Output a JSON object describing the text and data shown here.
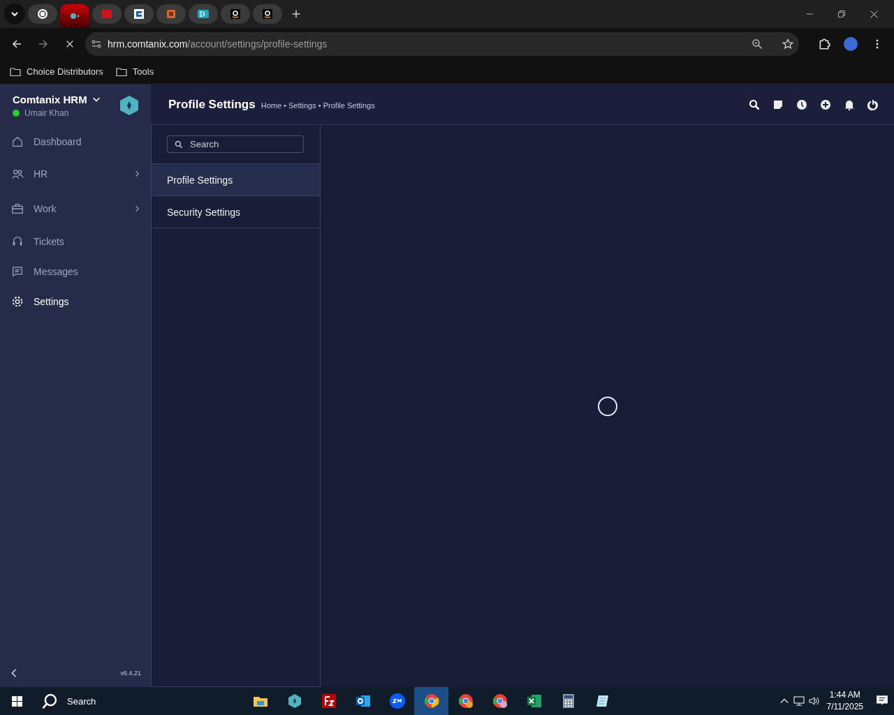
{
  "browser": {
    "tabs": [
      {
        "selected": false
      },
      {
        "selected": true
      },
      {
        "selected": false
      },
      {
        "selected": false
      },
      {
        "selected": false
      },
      {
        "selected": false
      },
      {
        "selected": false
      },
      {
        "selected": false
      }
    ],
    "url": {
      "host": "hrm.comtanix.com",
      "path": "/account/settings/profile-settings"
    },
    "bookmarks": [
      {
        "label": "Choice Distributors"
      },
      {
        "label": "Tools"
      }
    ]
  },
  "sidebar": {
    "brand": "Comtanix HRM",
    "user": {
      "name": "Umair Khan",
      "online": true
    },
    "items": [
      {
        "label": "Dashboard",
        "has_children": false,
        "selected": false
      },
      {
        "label": "HR",
        "has_children": true,
        "selected": false
      },
      {
        "label": "Work",
        "has_children": true,
        "selected": false
      },
      {
        "label": "Tickets",
        "has_children": false,
        "selected": false
      },
      {
        "label": "Messages",
        "has_children": false,
        "selected": false
      },
      {
        "label": "Settings",
        "has_children": false,
        "selected": true
      }
    ],
    "version": "v6.4.21"
  },
  "header": {
    "title": "Profile Settings",
    "breadcrumb": "Home • Settings • Profile Settings"
  },
  "settings_menu": {
    "search": {
      "placeholder": "Search"
    },
    "items": [
      {
        "label": "Profile Settings",
        "selected": true
      },
      {
        "label": "Security Settings",
        "selected": false
      }
    ]
  },
  "taskbar": {
    "search": {
      "placeholder": "Search"
    },
    "apps": [
      {
        "active": false
      },
      {
        "active": false
      },
      {
        "active": false
      },
      {
        "active": false
      },
      {
        "active": false
      },
      {
        "active": true
      },
      {
        "active": false
      },
      {
        "active": false
      },
      {
        "active": false
      },
      {
        "active": false
      },
      {
        "active": false
      }
    ],
    "time": "1:44 AM",
    "date": "7/11/2025"
  }
}
